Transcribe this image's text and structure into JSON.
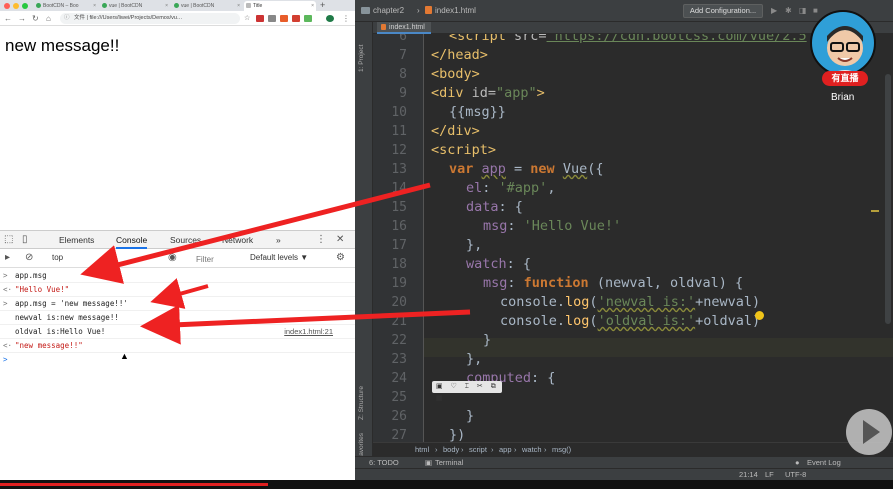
{
  "browser": {
    "tabs": [
      {
        "label": "BootCDN – Boo"
      },
      {
        "label": "vue | BootCDN"
      },
      {
        "label": "vue | BootCDN"
      },
      {
        "label": "Title"
      }
    ],
    "url_prefix": "文件",
    "url": "file:///Users/liwei/Projects/Demos/vu…",
    "page_message": "new message!!"
  },
  "devtools": {
    "tabs": [
      "Elements",
      "Console",
      "Sources",
      "Network"
    ],
    "more": "»",
    "context": "top",
    "filter_placeholder": "Filter",
    "levels": "Default levels ▼",
    "console": [
      {
        "prefix": ">",
        "text": "app.msg"
      },
      {
        "prefix": "<·",
        "text": "\"Hello Vue!\"",
        "is_string": true
      },
      {
        "prefix": ">",
        "text": "app.msg = 'new message!!'"
      },
      {
        "prefix": "",
        "text": "newval is:new message!!"
      },
      {
        "prefix": "",
        "text": "oldval is:Hello Vue!",
        "source": "index1.html:21"
      },
      {
        "prefix": "<·",
        "text": "\"new message!!\"",
        "is_string": true
      },
      {
        "prefix": ">",
        "text": ""
      }
    ]
  },
  "ide": {
    "project": "chapter2",
    "file": "index1.html",
    "add_config": "Add Configuration...",
    "editor_tab": "index1.html",
    "rail": {
      "project": "1: Project",
      "structure": "Z: Structure",
      "favorites": "2: Favorites"
    },
    "line_numbers": [
      "6",
      "7",
      "8",
      "9",
      "10",
      "11",
      "12",
      "13",
      "14",
      "15",
      "16",
      "17",
      "18",
      "19",
      "20",
      "21",
      "22",
      "23",
      "24",
      "25",
      "26",
      "27"
    ],
    "code": {
      "l6_tag": "<script ",
      "l6_attr": "src=",
      "l6_url": "\"https://cdn.bootcss.com/vue/2.5",
      "l7": "</head>",
      "l8": "<body>",
      "l9_tag": "<div ",
      "l9_attr": "id=",
      "l9_val": "\"app\"",
      "l9_end": ">",
      "l10": "{{msg}}",
      "l11": "</div>",
      "l12": "<script>",
      "l13_var": "var ",
      "l13_app": "app",
      "l13_eq": " = ",
      "l13_new": "new ",
      "l13_vue": "Vue",
      "l13_end": "({",
      "l14_key": "el",
      "l14_colon": ": ",
      "l14_val": "'#app'",
      "l14_end": ",",
      "l15_key": "data",
      "l15_end": ": {",
      "l16_key": "msg",
      "l16_colon": ": ",
      "l16_val": "'Hello Vue!'",
      "l17": "},",
      "l18_key": "watch",
      "l18_end": ": {",
      "l19_key": "msg",
      "l19_colon": ": ",
      "l19_fn": "function ",
      "l19_params": "(newval, oldval) {",
      "l20_pre": "console.",
      "l20_log": "log",
      "l20_open": "(",
      "l20_str": "'newval is:'",
      "l20_end": "+newval)",
      "l21_pre": "console.",
      "l21_log": "log",
      "l21_open": "(",
      "l21_str": "'oldval is:'",
      "l21_end": "+oldval)",
      "l22": "}",
      "l23": "},",
      "l24_key": "computed",
      "l24_end": ": {",
      "l25": "",
      "l26": "}",
      "l27": "})"
    },
    "breadcrumbs": [
      "html",
      "body",
      "script",
      "app",
      "watch",
      "msg()"
    ],
    "bottom_tabs": {
      "todo": "6: TODO",
      "terminal": "Terminal",
      "event_log": "Event Log"
    },
    "status": {
      "position": "21:14",
      "line_sep": "LF",
      "encoding": "UTF-8"
    },
    "float_toolbar": "▣ ♡ ⌶ ✂ ⧉ ▦"
  },
  "overlay": {
    "live_badge": "有直播",
    "streamer_name": "Brian"
  },
  "video": {
    "progress_fraction": 0.3
  }
}
